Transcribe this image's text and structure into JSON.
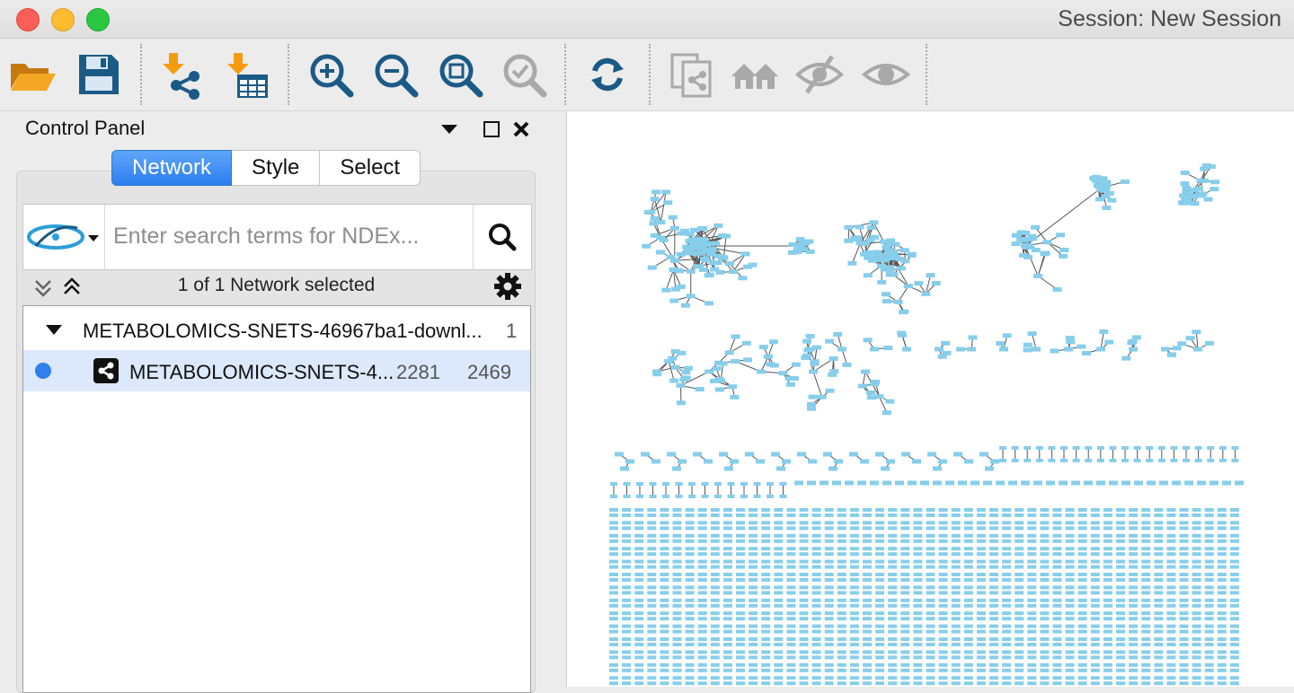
{
  "window": {
    "title": "Session: New Session"
  },
  "toolbar": {
    "buttons": [
      {
        "name": "open-session-button",
        "icon": "folder-open-icon"
      },
      {
        "name": "save-session-button",
        "icon": "floppy-disk-icon"
      },
      {
        "name": "import-network-button",
        "icon": "import-network-icon"
      },
      {
        "name": "import-table-button",
        "icon": "import-table-icon"
      },
      {
        "name": "zoom-in-button",
        "icon": "zoom-in-icon"
      },
      {
        "name": "zoom-out-button",
        "icon": "zoom-out-icon"
      },
      {
        "name": "zoom-fit-button",
        "icon": "zoom-fit-icon"
      },
      {
        "name": "zoom-selected-button",
        "icon": "zoom-selected-icon"
      },
      {
        "name": "apply-layout-button",
        "icon": "refresh-icon"
      },
      {
        "name": "new-network-from-selection-button",
        "icon": "copy-network-icon"
      },
      {
        "name": "home-button",
        "icon": "home-icon"
      },
      {
        "name": "hide-selected-button",
        "icon": "eye-slash-icon"
      },
      {
        "name": "show-all-button",
        "icon": "eye-icon"
      }
    ]
  },
  "control_panel": {
    "title": "Control Panel",
    "tabs": [
      {
        "label": "Network",
        "active": true
      },
      {
        "label": "Style",
        "active": false
      },
      {
        "label": "Select",
        "active": false
      }
    ],
    "search": {
      "placeholder": "Enter search terms for NDEx..."
    },
    "network_count": "1 of 1 Network selected",
    "networks": [
      {
        "name": "METABOLOMICS-SNETS-46967ba1-downl...",
        "count": "1"
      },
      {
        "name": "METABOLOMICS-SNETS-4...",
        "nodes": "2281",
        "edges": "2469"
      }
    ]
  },
  "colors": {
    "accent": "#2c7df0",
    "node": "#87ceeb",
    "edge": "#555555",
    "icon_blue": "#1a5e8c",
    "icon_orange": "#f39c12"
  }
}
